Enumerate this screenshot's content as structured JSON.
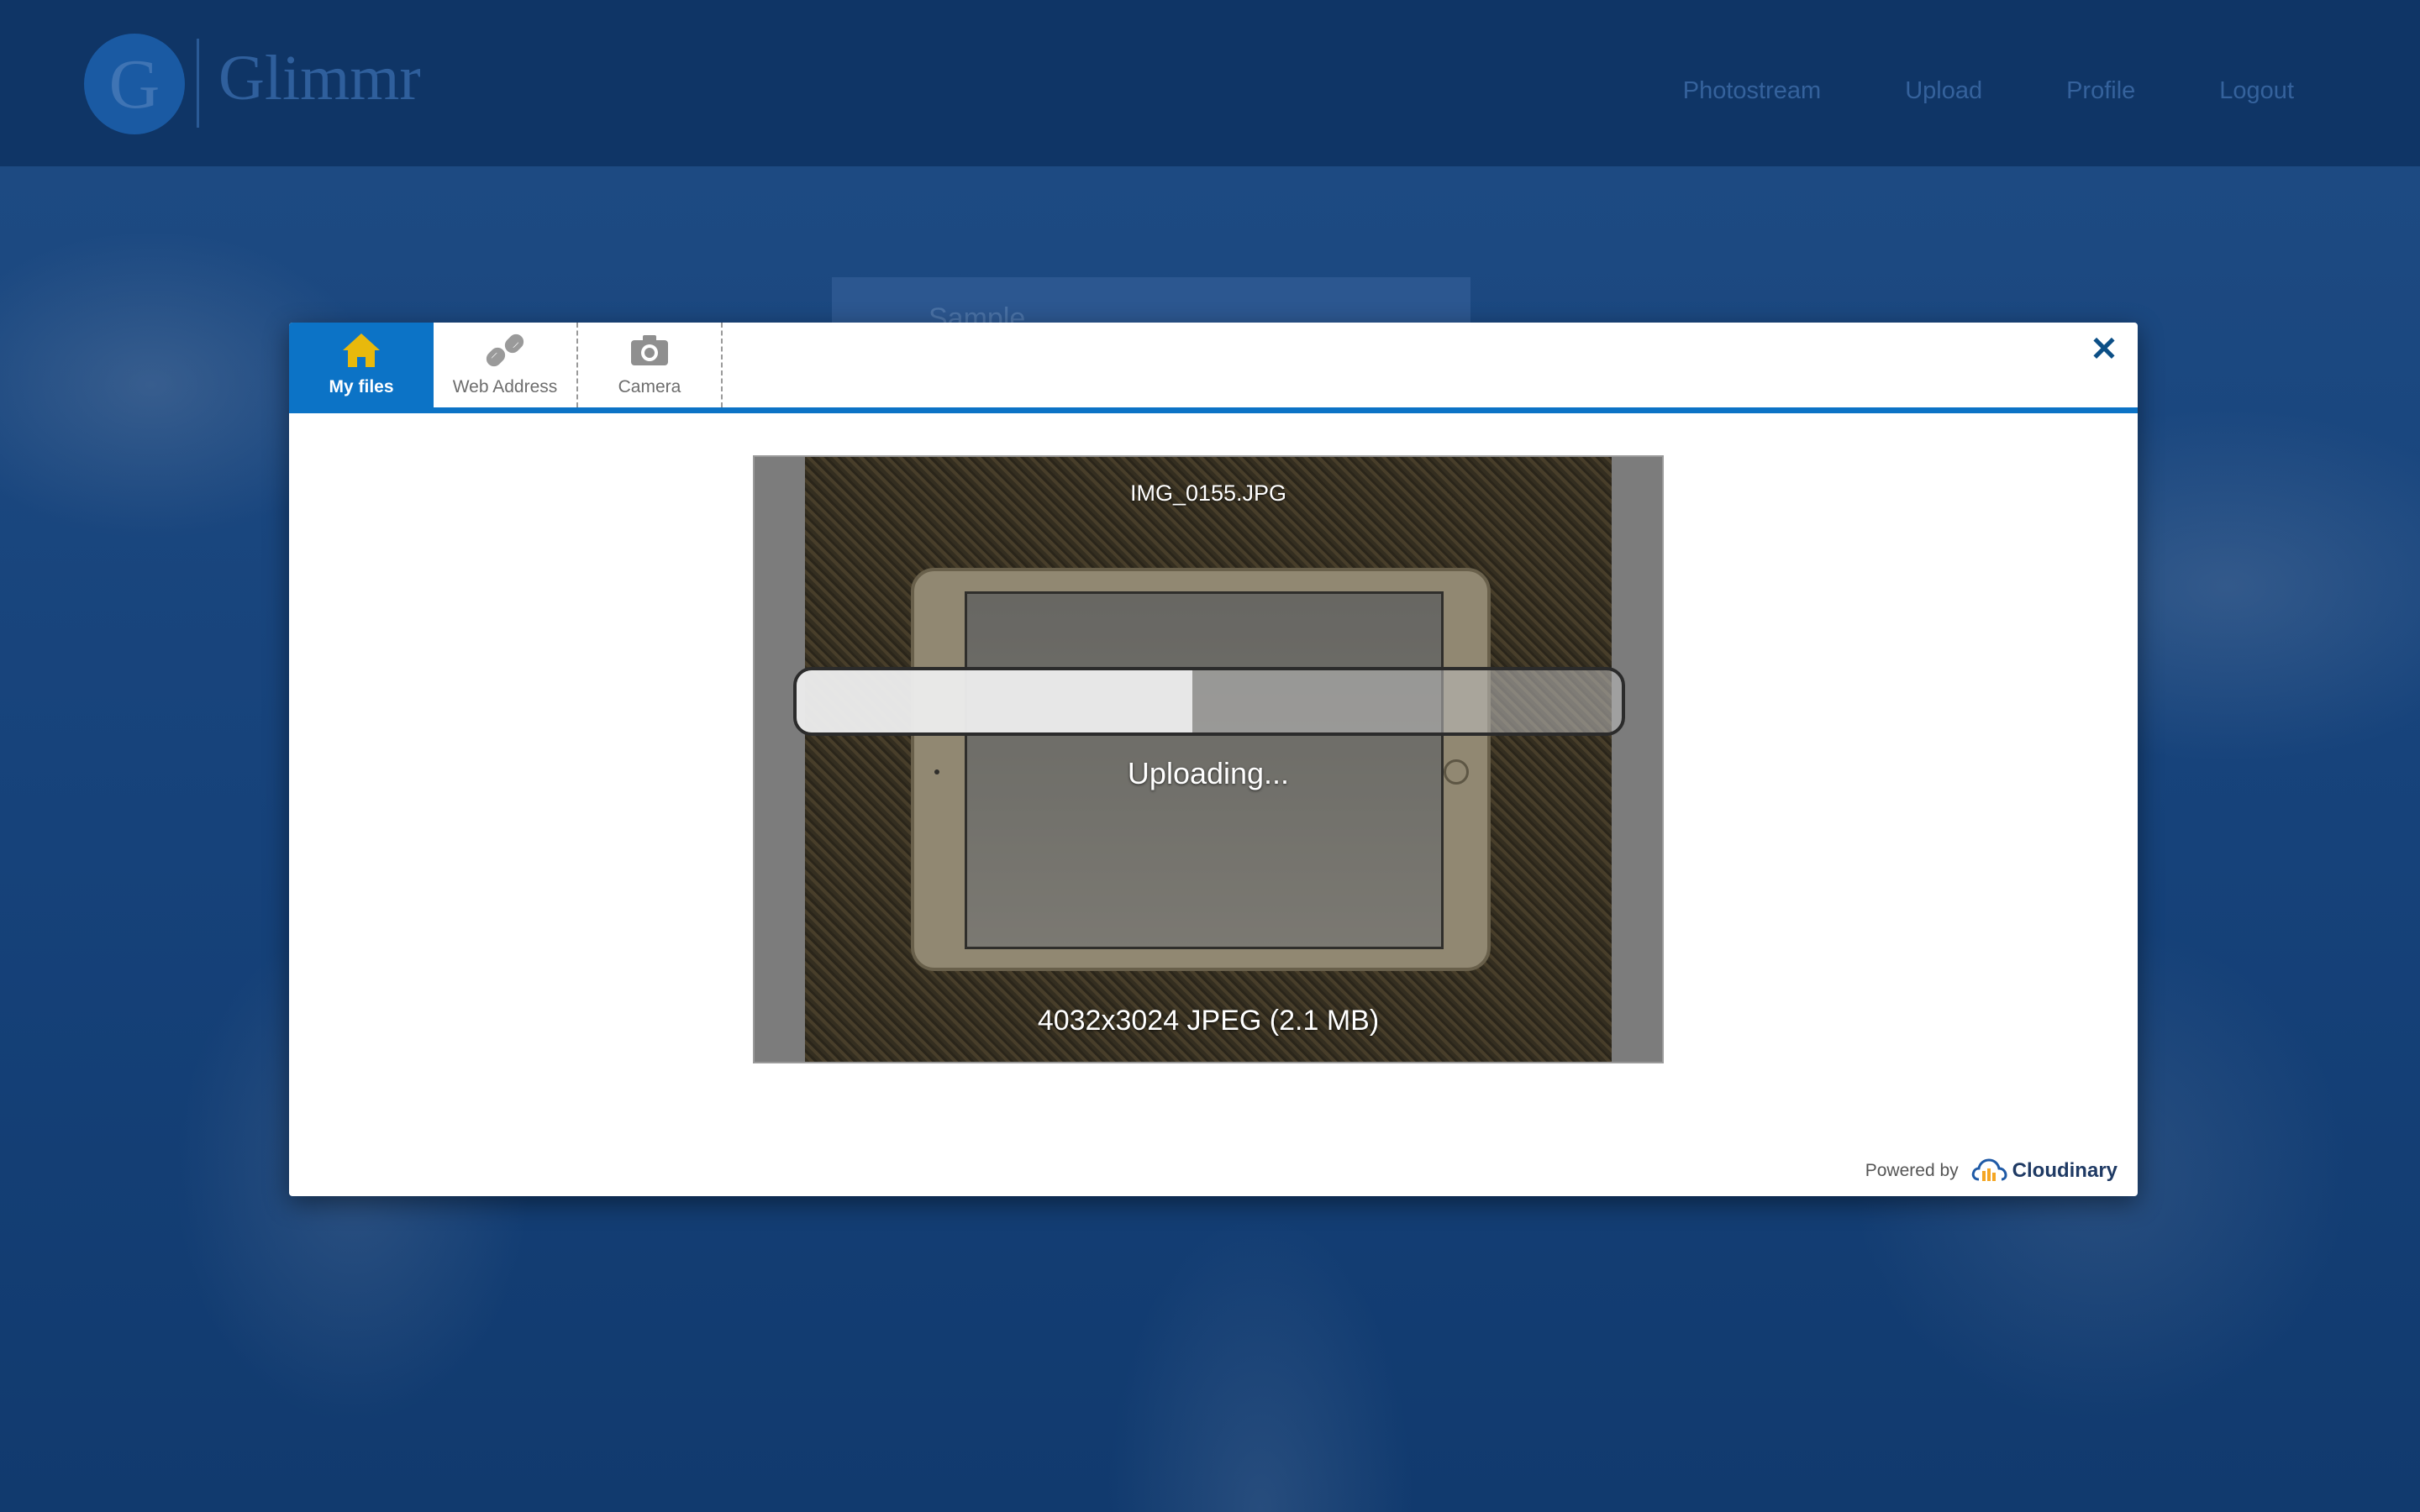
{
  "app": {
    "logo_letter": "G",
    "logo_name": "Glimmr",
    "nav": [
      "Photostream",
      "Upload",
      "Profile",
      "Logout"
    ],
    "background_card_text": "Sample"
  },
  "widget": {
    "tabs": [
      {
        "label": "My files",
        "icon": "home-icon",
        "active": true
      },
      {
        "label": "Web Address",
        "icon": "link-icon",
        "active": false
      },
      {
        "label": "Camera",
        "icon": "camera-icon",
        "active": false
      }
    ],
    "close_label": "✕",
    "file": {
      "name": "IMG_0155.JPG",
      "info": "4032x3024  JPEG (2.1 MB)"
    },
    "upload": {
      "status": "Uploading...",
      "progress": 0.48
    },
    "powered_by": "Powered by",
    "brand": "Cloudinary",
    "colors": {
      "accent": "#0c73c6",
      "home_icon": "#e8b90c"
    }
  }
}
